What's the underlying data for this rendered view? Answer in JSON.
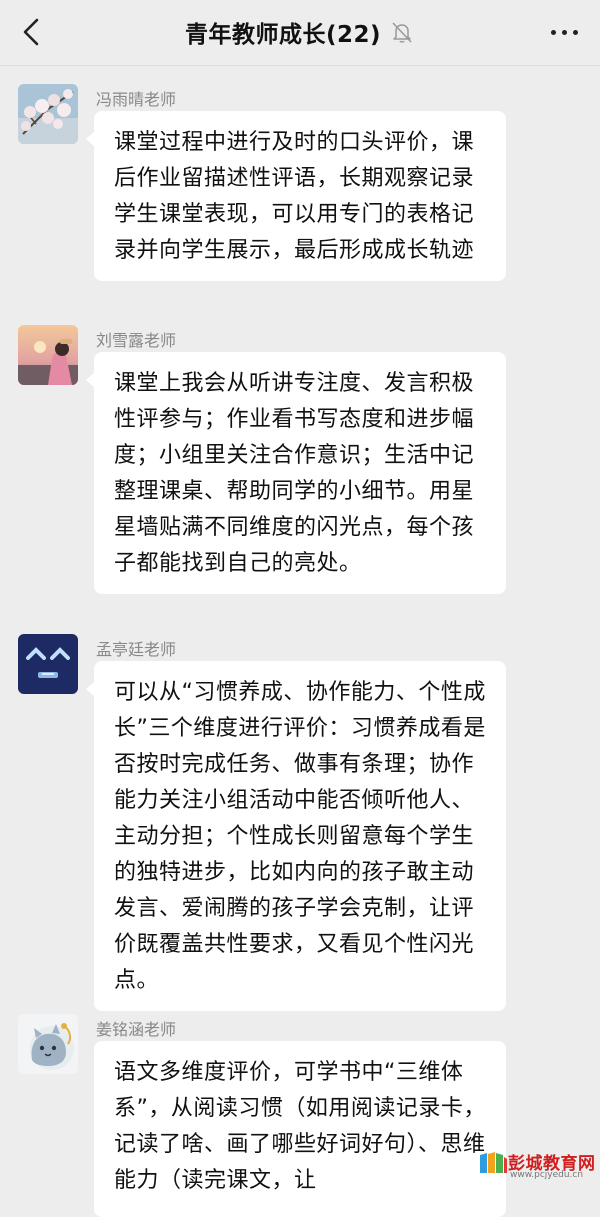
{
  "header": {
    "title": "青年教师成长(22)",
    "back_icon": "chevron-left-icon",
    "mute_icon": "bell-muted-icon",
    "more_icon": "more-dots-icon"
  },
  "messages": [
    {
      "sender": "冯雨晴老师",
      "avatar": "cherry-blossom-photo",
      "text": "课堂过程中进行及时的口头评价，课后作业留描述性评语，长期观察记录学生课堂表现，可以用专门的表格记录并向学生展示，最后形成成长轨迹"
    },
    {
      "sender": "刘雪露老师",
      "avatar": "sunset-portrait-photo",
      "text": "课堂上我会从听讲专注度、发言积极性评参与；作业看书写态度和进步幅度；小组里关注合作意识；生活中记整理课桌、帮助同学的小细节。用星星墙贴满不同维度的闪光点，每个孩子都能找到自己的亮处。"
    },
    {
      "sender": "孟亭廷老师",
      "avatar": "blue-smiley-avatar",
      "text": "可以从“习惯养成、协作能力、个性成长”三个维度进行评价：习惯养成看是否按时完成任务、做事有条理；协作能力关注小组活动中能否倾听他人、主动分担；个性成长则留意每个学生的独特进步，比如内向的孩子敢主动发言、爱闹腾的孩子学会克制，让评价既覆盖共性要求，又看见个性闪光点。"
    },
    {
      "sender": "姜铭涵老师",
      "avatar": "cartoon-cat-avatar",
      "text": "语文多维度评价，可学书中“三维体系”，从阅读习惯（如用阅读记录卡，记读了啥、画了哪些好词好句）、思维能力（读完课文，让"
    }
  ],
  "watermark": {
    "name": "彭城教育网",
    "url": "www.pcjyedu.cn"
  },
  "colors": {
    "background": "#ededed",
    "bubble": "#ffffff",
    "sender_text": "#888888",
    "watermark_red": "#d21e1e"
  }
}
